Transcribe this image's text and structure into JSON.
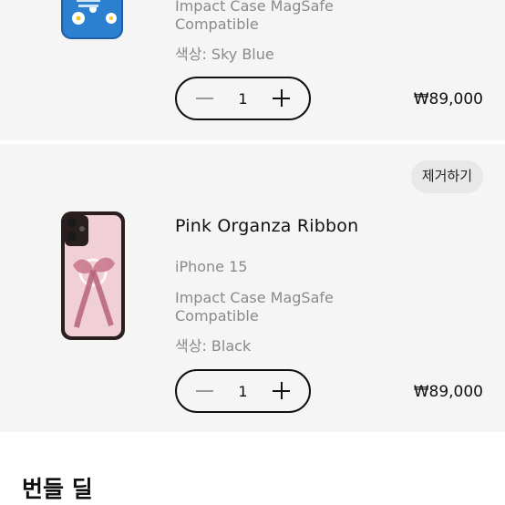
{
  "items": [
    {
      "model": "Impact Case MagSafe",
      "model_line2": "Compatible",
      "color_label": "색상: Sky Blue",
      "quantity": "1",
      "price": "₩89,000"
    },
    {
      "remove_label": "제거하기",
      "name": "Pink Organza Ribbon",
      "device": "iPhone 15",
      "model": "Impact Case MagSafe",
      "model_line2": "Compatible",
      "color_label": "색상: Black",
      "quantity": "1",
      "price": "₩89,000"
    }
  ],
  "bundle": {
    "title": "번들 딜"
  },
  "icons": {
    "minus": "minus-icon",
    "plus": "plus-icon"
  },
  "colors": {
    "stepper_border": "#111111",
    "card_bg": "#f5f5f5",
    "remove_bg": "#e8e8e8"
  }
}
